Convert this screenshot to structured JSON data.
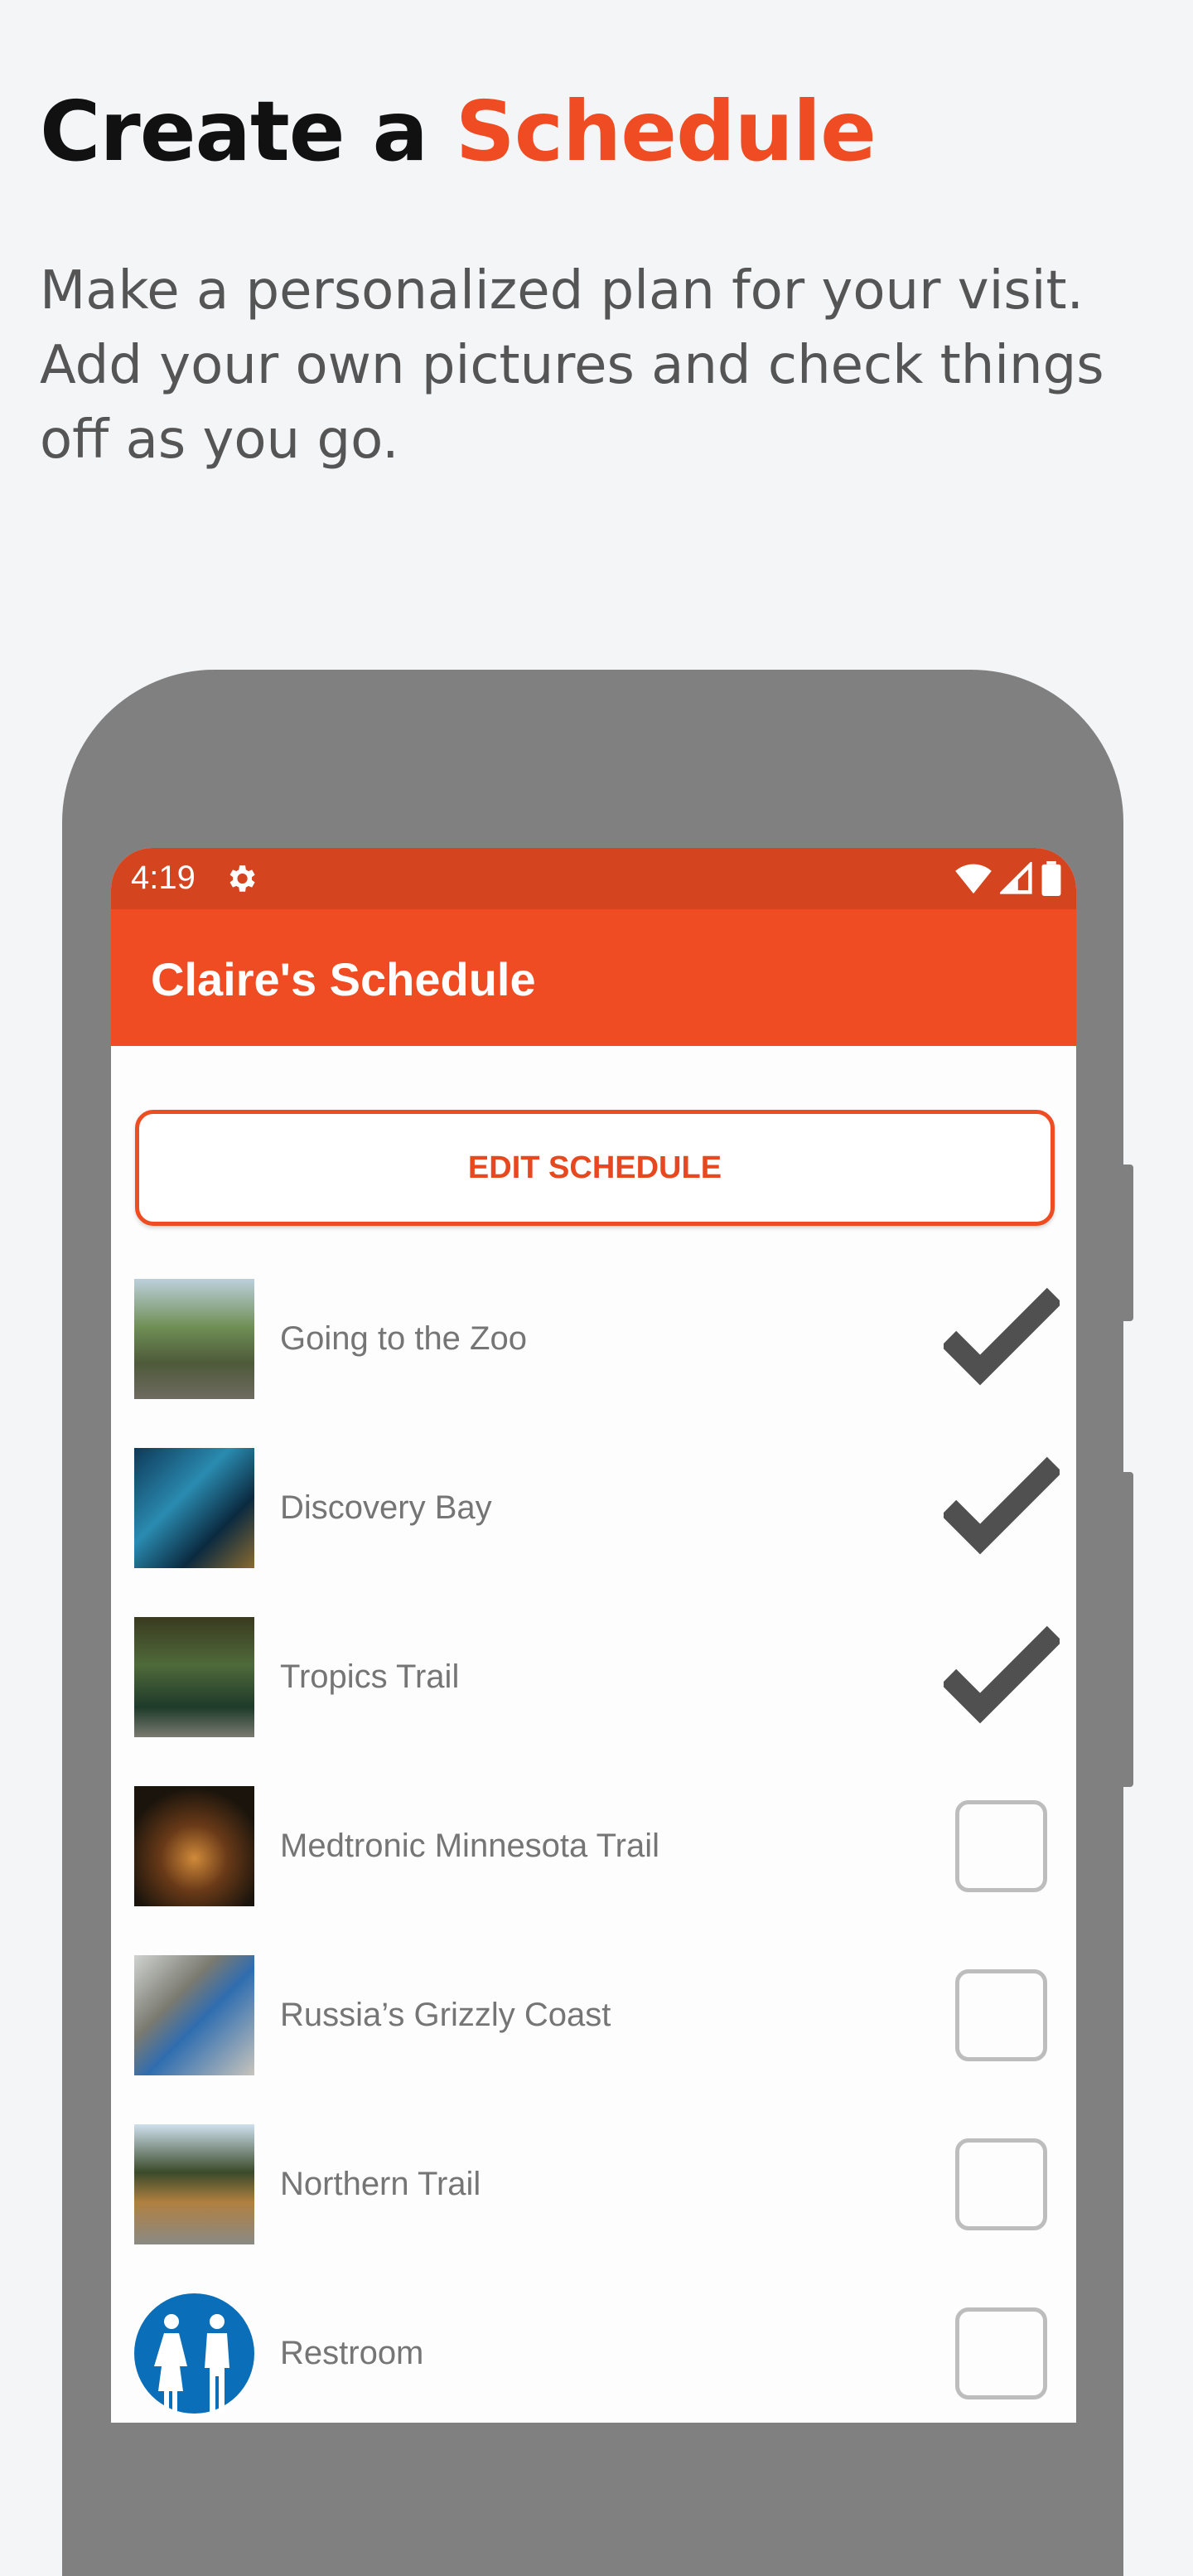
{
  "headline": {
    "prefix": "Create a ",
    "accent": "Schedule"
  },
  "intro": "Make a personalized plan for your visit. Add your own pictures and check things off as you go.",
  "colors": {
    "accent": "#f04c23",
    "status_bar": "#d4441f",
    "phone": "#808080"
  },
  "status_bar": {
    "time": "4:19",
    "icons": [
      "gear-icon",
      "wifi-icon",
      "signal-icon",
      "battery-icon"
    ]
  },
  "app_bar": {
    "title": "Claire's Schedule"
  },
  "edit_button": "EDIT SCHEDULE",
  "items": [
    {
      "label": "Going to the Zoo",
      "checked": true
    },
    {
      "label": "Discovery Bay",
      "checked": true
    },
    {
      "label": "Tropics Trail",
      "checked": true
    },
    {
      "label": "Medtronic Minnesota Trail",
      "checked": false
    },
    {
      "label": "Russia’s Grizzly Coast",
      "checked": false
    },
    {
      "label": "Northern Trail",
      "checked": false
    },
    {
      "label": "Restroom",
      "checked": false
    }
  ]
}
